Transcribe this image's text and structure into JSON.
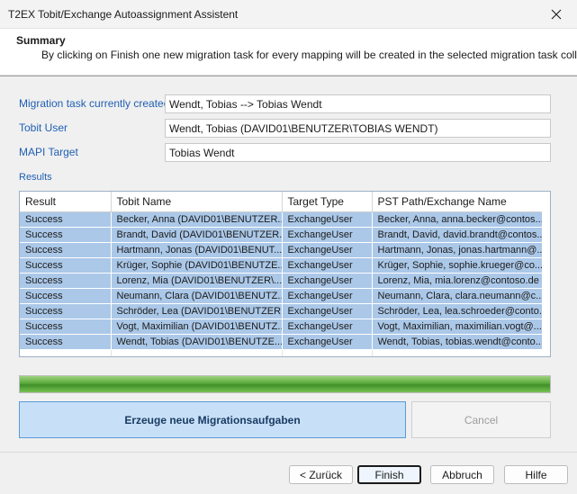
{
  "window": {
    "title": "T2EX Tobit/Exchange Autoassignment Assistent",
    "close_icon": "close-icon"
  },
  "header": {
    "title": "Summary",
    "description": "By clicking on Finish one new migration task for every mapping will be created in the selected migration task collection"
  },
  "form": {
    "current_task_label": "Migration task currently created",
    "current_task_value": "Wendt, Tobias --> Tobias Wendt",
    "tobit_user_label": "Tobit User",
    "tobit_user_value": "Wendt, Tobias (DAVID01\\BENUTZER\\TOBIAS WENDT)",
    "mapi_target_label": "MAPI Target",
    "mapi_target_value": "Tobias Wendt",
    "results_label": "Results"
  },
  "results": {
    "columns": [
      "Result",
      "Tobit Name",
      "Target Type",
      "PST Path/Exchange Name"
    ],
    "rows": [
      [
        "Success",
        "Becker, Anna (DAVID01\\BENUTZER...",
        "ExchangeUser",
        "Becker, Anna, anna.becker@contos..."
      ],
      [
        "Success",
        "Brandt, David (DAVID01\\BENUTZER...",
        "ExchangeUser",
        "Brandt, David, david.brandt@contos..."
      ],
      [
        "Success",
        "Hartmann, Jonas (DAVID01\\BENUT...",
        "ExchangeUser",
        "Hartmann, Jonas, jonas.hartmann@..."
      ],
      [
        "Success",
        "Krüger, Sophie (DAVID01\\BENUTZE...",
        "ExchangeUser",
        "Krüger, Sophie, sophie.krueger@co..."
      ],
      [
        "Success",
        "Lorenz, Mia (DAVID01\\BENUTZER\\...",
        "ExchangeUser",
        "Lorenz, Mia, mia.lorenz@contoso.de"
      ],
      [
        "Success",
        "Neumann, Clara (DAVID01\\BENUTZ...",
        "ExchangeUser",
        "Neumann, Clara, clara.neumann@c..."
      ],
      [
        "Success",
        "Schröder, Lea (DAVID01\\BENUTZER...",
        "ExchangeUser",
        "Schröder, Lea, lea.schroeder@conto..."
      ],
      [
        "Success",
        "Vogt, Maximilian (DAVID01\\BENUTZ...",
        "ExchangeUser",
        "Vogt, Maximilian, maximilian.vogt@..."
      ],
      [
        "Success",
        "Wendt, Tobias (DAVID01\\BENUTZE...",
        "ExchangeUser",
        "Wendt, Tobias, tobias.wendt@conto..."
      ]
    ]
  },
  "progress": {
    "value_percent": 100
  },
  "actions": {
    "create_label": "Erzeuge  neue  Migrationsaufgaben",
    "cancel_label": "Cancel"
  },
  "footer": {
    "back_label": "< Zurück",
    "finish_label": "Finish",
    "abort_label": "Abbruch",
    "help_label": "Hilfe"
  },
  "colors": {
    "label_blue": "#1f5fb3",
    "selection": "#abc8e8",
    "primary_button": "#c7e0f8",
    "progress_green": "#58a83a"
  }
}
